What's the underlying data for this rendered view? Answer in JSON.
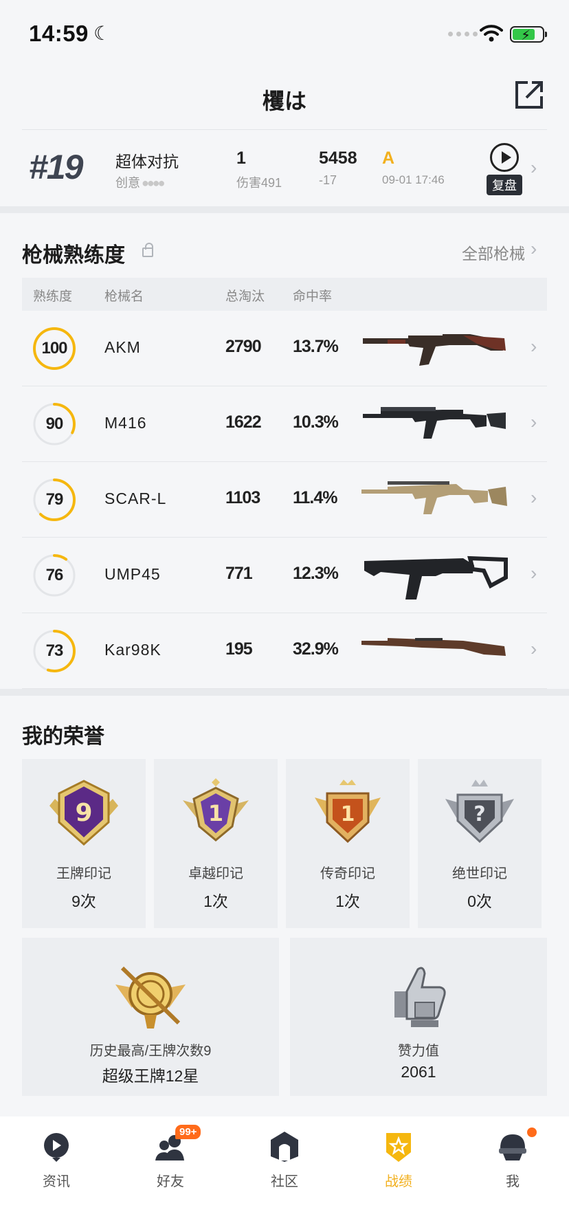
{
  "status_bar": {
    "time": "14:59"
  },
  "header": {
    "title": "欔は"
  },
  "recent_match": {
    "rank": "#19",
    "mode": "超体对抗",
    "sub": "创意",
    "kills": "1",
    "damage": "伤害491",
    "score": "5458",
    "delta": "-17",
    "grade": "A",
    "date": "09-01 17:46",
    "replay_label": "复盘"
  },
  "weapons": {
    "title": "枪械熟练度",
    "all_link": "全部枪械",
    "headers": {
      "mastery": "熟练度",
      "name": "枪械名",
      "kills": "总淘汰",
      "accuracy": "命中率"
    },
    "ring_color": "#f5b70f",
    "rows": [
      {
        "mastery": "100",
        "progress": 1.0,
        "name": "AKM",
        "kills": "2790",
        "accuracy": "13.7%",
        "icon": "akm-rifle-icon"
      },
      {
        "mastery": "90",
        "progress": 0.32,
        "name": "M416",
        "kills": "1622",
        "accuracy": "10.3%",
        "icon": "m416-rifle-icon"
      },
      {
        "mastery": "79",
        "progress": 0.62,
        "name": "SCAR-L",
        "kills": "1103",
        "accuracy": "11.4%",
        "icon": "scarl-rifle-icon"
      },
      {
        "mastery": "76",
        "progress": 0.1,
        "name": "UMP45",
        "kills": "771",
        "accuracy": "12.3%",
        "icon": "ump45-smg-icon"
      },
      {
        "mastery": "73",
        "progress": 0.55,
        "name": "Kar98K",
        "kills": "195",
        "accuracy": "32.9%",
        "icon": "kar98k-sniper-icon"
      }
    ]
  },
  "honors": {
    "title": "我的荣誉",
    "cards": [
      {
        "name": "王牌印记",
        "count": "9次",
        "icon": "ace-mark-badge-icon",
        "badge_text": "9"
      },
      {
        "name": "卓越印记",
        "count": "1次",
        "icon": "excellence-mark-badge-icon",
        "badge_text": "1"
      },
      {
        "name": "传奇印记",
        "count": "1次",
        "icon": "legend-mark-badge-icon",
        "badge_text": "1"
      },
      {
        "name": "绝世印记",
        "count": "0次",
        "icon": "peerless-mark-badge-icon",
        "badge_text": "?"
      }
    ],
    "history": {
      "label": "历史最高/王牌次数9",
      "value": "超级王牌12星",
      "icon": "super-ace-badge-icon"
    },
    "likes": {
      "label": "赞力值",
      "value": "2061",
      "icon": "thumbs-up-trophy-icon"
    }
  },
  "bottom_nav": {
    "items": [
      {
        "label": "资讯",
        "icon": "news-icon"
      },
      {
        "label": "好友",
        "icon": "friends-icon",
        "badge": "99+"
      },
      {
        "label": "社区",
        "icon": "community-icon"
      },
      {
        "label": "战绩",
        "icon": "record-icon",
        "active": true
      },
      {
        "label": "我",
        "icon": "profile-icon",
        "dot": true
      }
    ]
  }
}
